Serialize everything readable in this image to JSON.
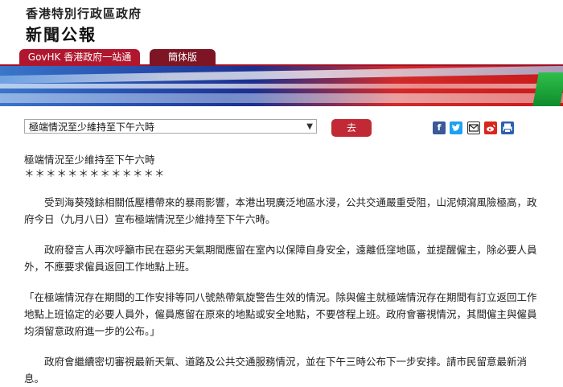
{
  "header": {
    "gov_name": "香港特別行政區政府",
    "press_title": "新聞公報"
  },
  "tabs": {
    "govhk": "GovHK 香港政府一站通",
    "simplified": "簡体版"
  },
  "controls": {
    "select_value": "極端情況至少維持至下午六時",
    "go_label": "去"
  },
  "share_icons": [
    "facebook-icon",
    "twitter-icon",
    "email-icon",
    "weibo-icon",
    "print-icon"
  ],
  "article": {
    "title": "極端情況至少維持至下午六時",
    "stars": "＊＊＊＊＊＊＊＊＊＊＊＊＊",
    "p1": "受到海葵殘餘相關低壓槽帶來的暴雨影響，本港出現廣泛地區水浸，公共交通嚴重受阻，山泥傾瀉風險極高，政府今日（九月八日）宣布極端情況至少維持至下午六時。",
    "p2": "政府發言人再次呼籲市民在惡劣天氣期間應留在室內以保障自身安全，遠離低窪地區，並提醒僱主，除必要人員外，不應要求僱員返回工作地點上班。",
    "p3": "「在極端情況存在期間的工作安排等同八號熱帶氣旋警告生效的情況。除與僱主就極端情況存在期間有訂立返回工作地點上班協定的必要人員外，僱員應留在原來的地點或安全地點，不要啓程上班。政府會審視情況，其間僱主與僱員均須留意政府進一步的公布。」",
    "p4": "政府會繼續密切審視最新天氣、道路及公共交通服務情況，並在下午三時公布下一步安排。請市民留意最新消息。"
  },
  "colors": {
    "accent_red": "#c12a34",
    "tab_red": "#b0172e",
    "tab_dark": "#7d1525"
  }
}
